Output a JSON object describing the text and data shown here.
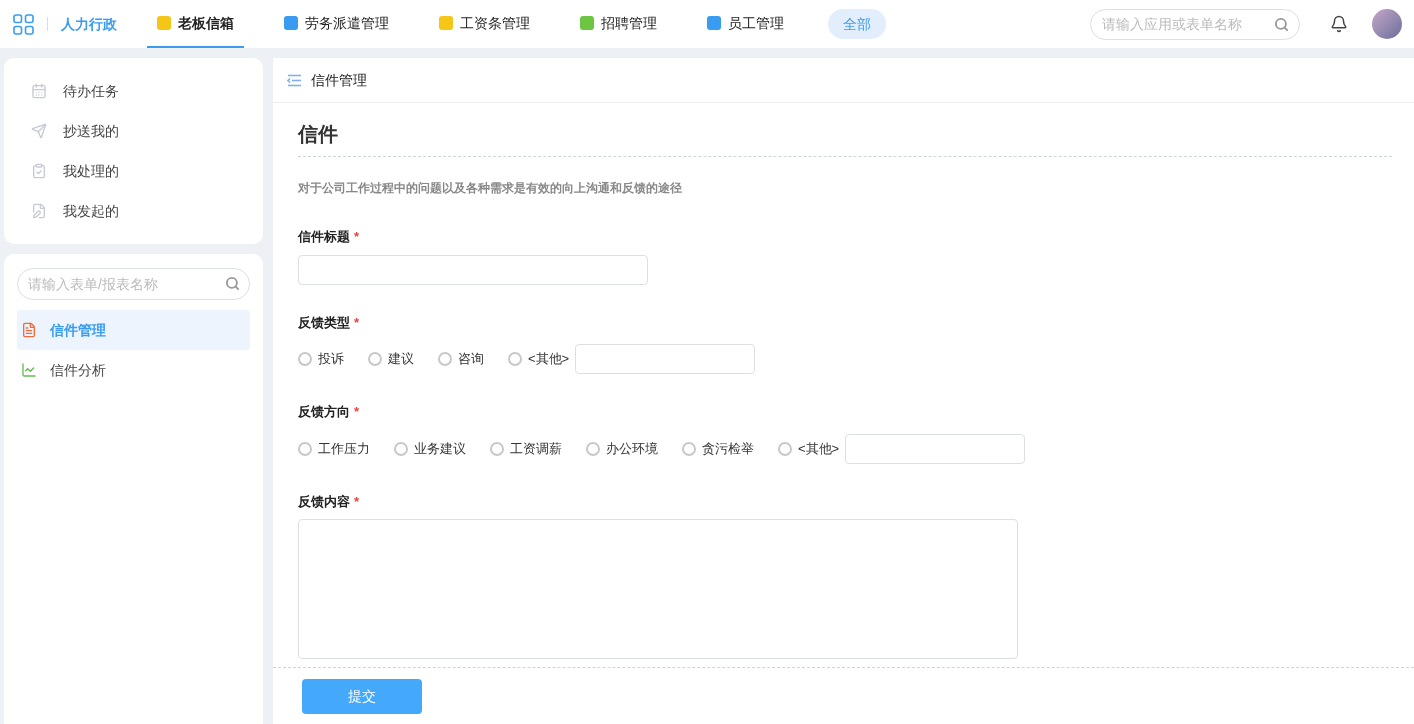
{
  "header": {
    "org": "人力行政",
    "apps": [
      {
        "label": "老板信箱",
        "color": "#f5c518",
        "selected": true
      },
      {
        "label": "劳务派遣管理",
        "color": "#3a9cf0",
        "selected": false
      },
      {
        "label": "工资条管理",
        "color": "#f5c518",
        "selected": false
      },
      {
        "label": "招聘管理",
        "color": "#6cc644",
        "selected": false
      },
      {
        "label": "员工管理",
        "color": "#3a9cf0",
        "selected": false
      }
    ],
    "all_button": "全部",
    "search": {
      "placeholder": "请输入应用或表单名称"
    }
  },
  "sidebar": {
    "tasks": [
      {
        "kind": "todo",
        "label": "待办任务"
      },
      {
        "kind": "cc",
        "label": "抄送我的"
      },
      {
        "kind": "handled",
        "label": "我处理的"
      },
      {
        "kind": "started",
        "label": "我发起的"
      }
    ],
    "search": {
      "placeholder": "请输入表单/报表名称"
    },
    "forms": [
      {
        "kind": "form",
        "label": "信件管理",
        "selected": true
      },
      {
        "kind": "report",
        "label": "信件分析",
        "selected": false
      }
    ]
  },
  "main": {
    "breadcrumb": "信件管理",
    "title": "信件",
    "description": "对于公司工作过程中的问题以及各种需求是有效的向上沟通和反馈的途径",
    "fields": [
      {
        "kind": "text",
        "label": "信件标题",
        "required_mark": "*"
      },
      {
        "kind": "radio",
        "label": "反馈类型",
        "required_mark": "*",
        "options": [
          {
            "kind": "choice",
            "label": "投诉",
            "selected": false
          },
          {
            "kind": "choice",
            "label": "建议",
            "selected": false
          },
          {
            "kind": "choice",
            "label": "咨询",
            "selected": false
          },
          {
            "kind": "other",
            "label": "<其他>",
            "selected": false
          }
        ]
      },
      {
        "kind": "radio",
        "label": "反馈方向",
        "required_mark": "*",
        "options": [
          {
            "kind": "choice",
            "label": "工作压力",
            "selected": false
          },
          {
            "kind": "choice",
            "label": "业务建议",
            "selected": false
          },
          {
            "kind": "choice",
            "label": "工资调薪",
            "selected": false
          },
          {
            "kind": "choice",
            "label": "办公环境",
            "selected": false
          },
          {
            "kind": "choice",
            "label": "贪污检举",
            "selected": false
          },
          {
            "kind": "other",
            "label": "<其他>",
            "selected": false
          }
        ]
      },
      {
        "kind": "textarea",
        "label": "反馈内容",
        "required_mark": "*"
      }
    ],
    "submit": "提交"
  }
}
